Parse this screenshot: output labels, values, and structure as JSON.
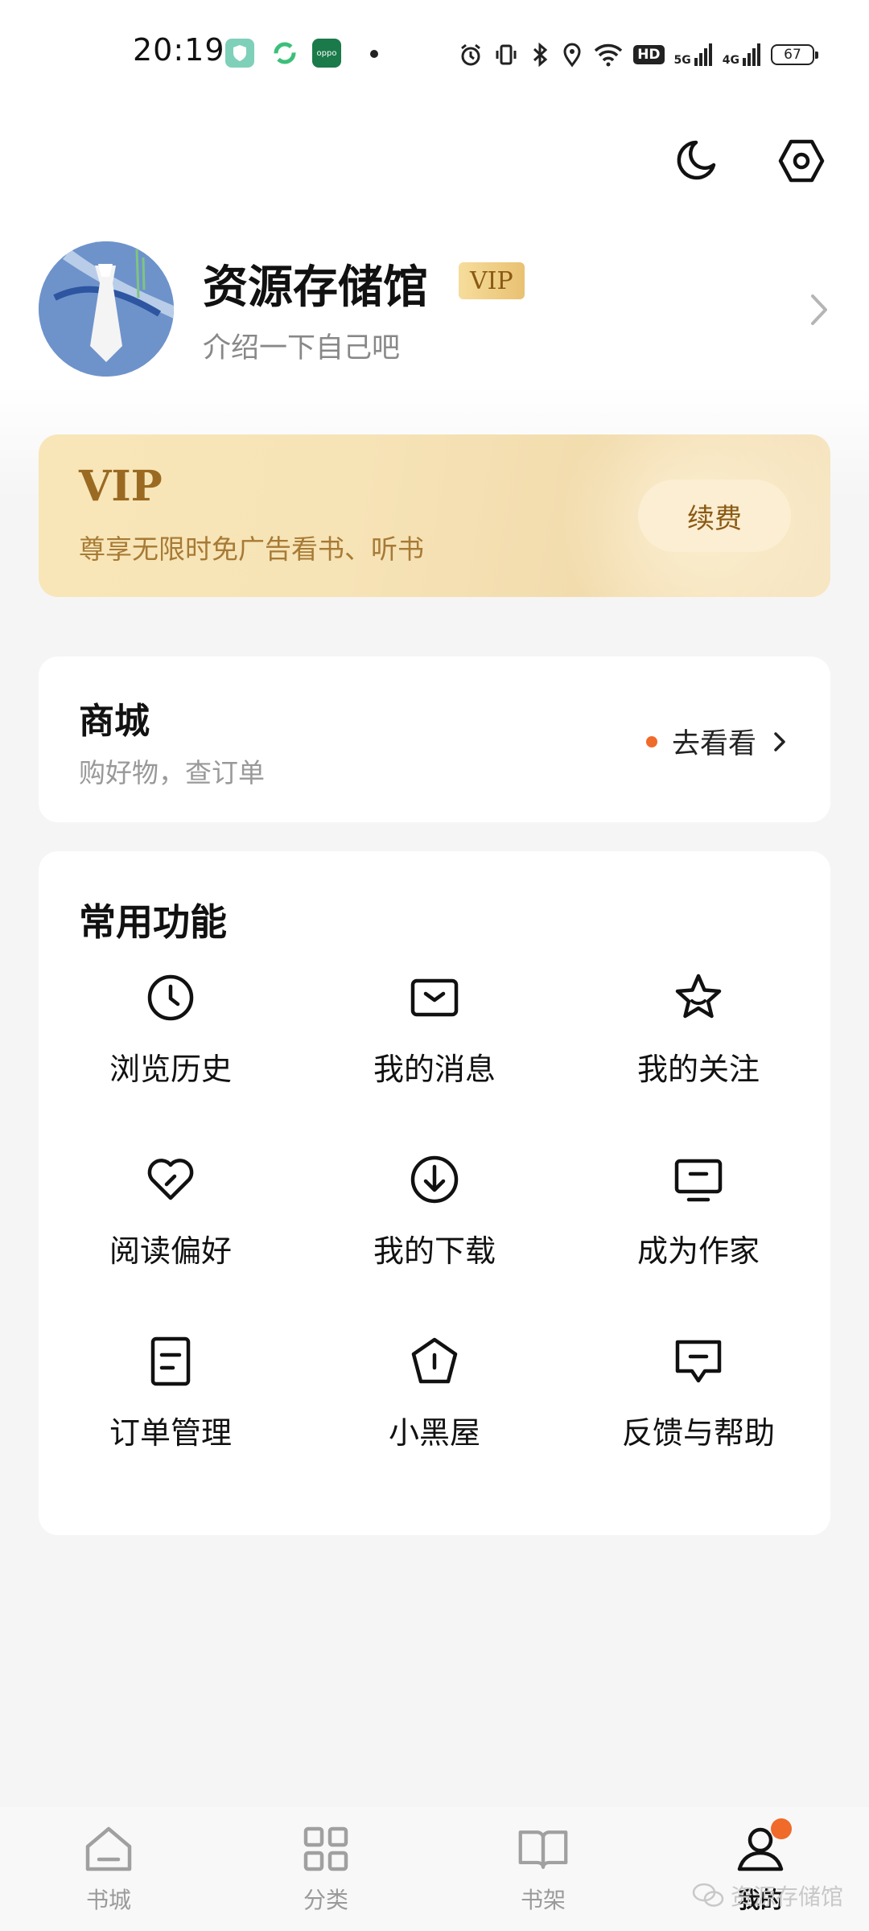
{
  "status_bar": {
    "time": "20:19",
    "network_badge": "HD",
    "network_5g": "5G",
    "network_4g": "4G",
    "battery": "67",
    "app_icon_label": "oppo"
  },
  "profile": {
    "username": "资源存储馆",
    "vip_badge": "VIP",
    "bio": "介绍一下自己吧"
  },
  "vip_banner": {
    "title": "VIP",
    "description": "尊享无限时免广告看书、听书",
    "renew_button": "续费"
  },
  "mall": {
    "title": "商城",
    "subtitle": "购好物，查订单",
    "link": "去看看"
  },
  "functions": {
    "title": "常用功能",
    "items": [
      {
        "label": "浏览历史",
        "icon": "clock-icon"
      },
      {
        "label": "我的消息",
        "icon": "message-box-icon"
      },
      {
        "label": "我的关注",
        "icon": "star-icon"
      },
      {
        "label": "阅读偏好",
        "icon": "heart-icon"
      },
      {
        "label": "我的下载",
        "icon": "download-icon"
      },
      {
        "label": "成为作家",
        "icon": "monitor-icon"
      },
      {
        "label": "订单管理",
        "icon": "document-icon"
      },
      {
        "label": "小黑屋",
        "icon": "pentagon-icon"
      },
      {
        "label": "反馈与帮助",
        "icon": "feedback-icon"
      }
    ]
  },
  "tabbar": {
    "tabs": [
      {
        "label": "书城",
        "icon": "home-icon"
      },
      {
        "label": "分类",
        "icon": "grid-icon"
      },
      {
        "label": "书架",
        "icon": "book-icon"
      },
      {
        "label": "我的",
        "icon": "user-icon",
        "active": true
      }
    ]
  },
  "watermark": "资源存储馆",
  "colors": {
    "accent_orange": "#f06a2a",
    "vip_gold": "#9a6a22",
    "vip_banner_bg": "#f6e3b6",
    "page_bg": "#f5f5f5"
  }
}
